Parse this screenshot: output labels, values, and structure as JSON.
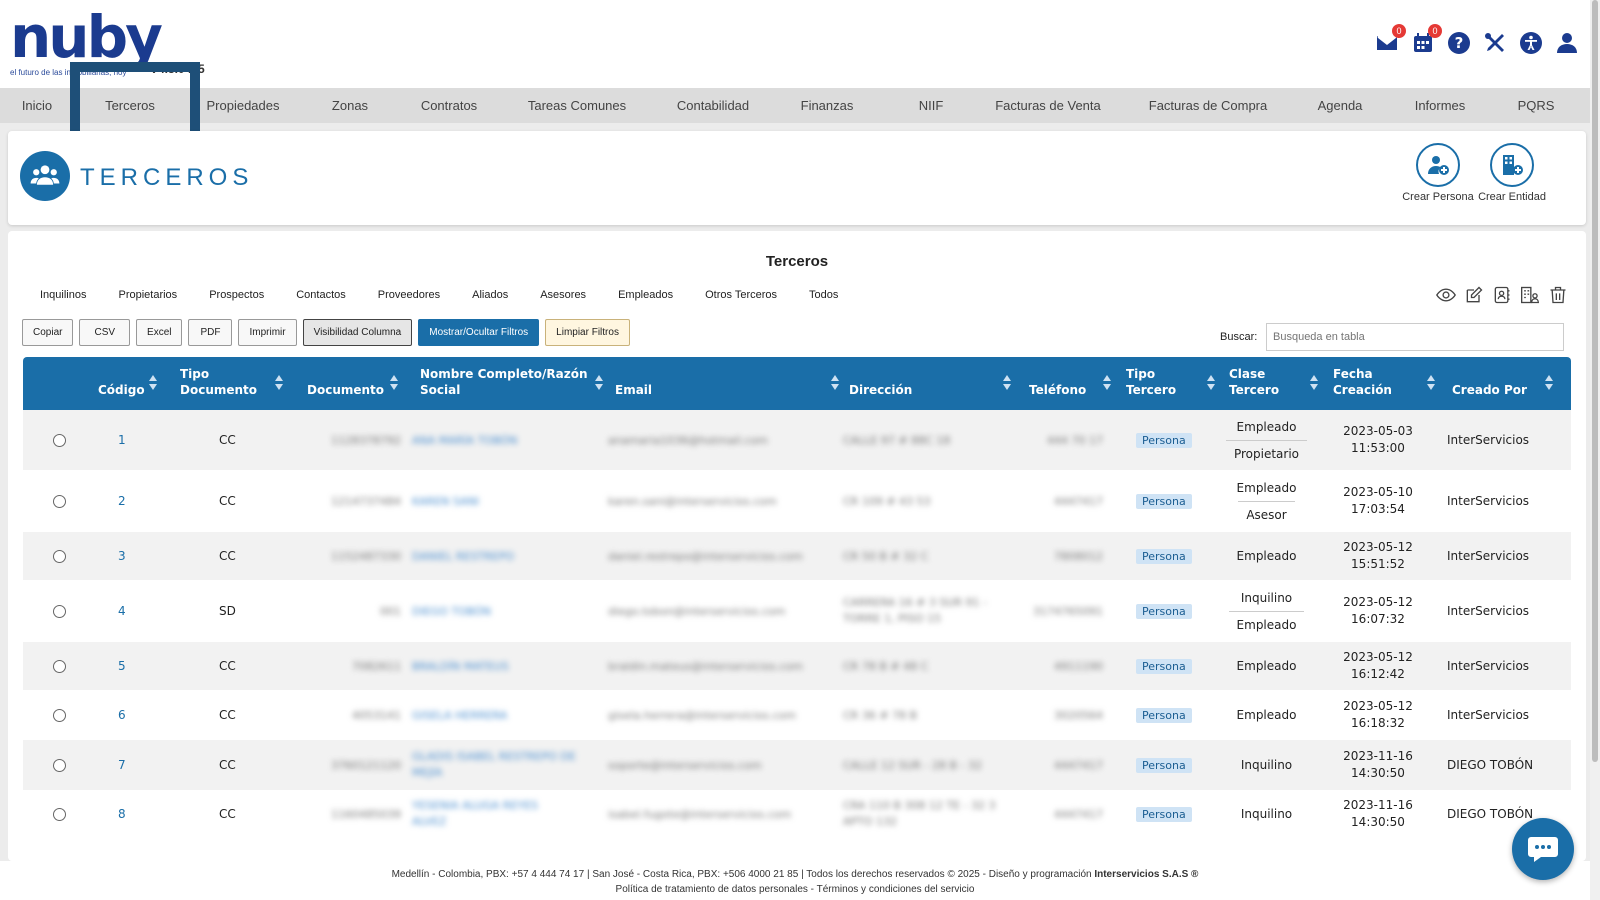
{
  "header": {
    "brand": "nuby",
    "tagline": "el futuro de las inmobiliarias, hoy",
    "version": "V4.5.0 .15",
    "mail_badge": "0",
    "calendar_badge": "0"
  },
  "nav": {
    "items": [
      "Inicio",
      "Terceros",
      "Propiedades",
      "Zonas",
      "Contratos",
      "Tareas Comunes",
      "Contabilidad",
      "Finanzas",
      "NIIF",
      "Facturas de Venta",
      "Facturas de Compra",
      "Agenda",
      "Informes",
      "PQRS"
    ]
  },
  "page": {
    "title": "TERCEROS",
    "create_person": "Crear Persona",
    "create_entity": "Crear Entidad"
  },
  "table": {
    "title": "Terceros",
    "filters": [
      "Inquilinos",
      "Propietarios",
      "Prospectos",
      "Contactos",
      "Proveedores",
      "Aliados",
      "Asesores",
      "Empleados",
      "Otros Terceros",
      "Todos"
    ],
    "buttons": {
      "copy": "Copiar",
      "csv": "CSV",
      "excel": "Excel",
      "pdf": "PDF",
      "print": "Imprimir",
      "columns": "Visibilidad Columna",
      "toggle_filters": "Mostrar/Ocultar Filtros",
      "clear_filters": "Limpiar Filtros"
    },
    "search_label": "Buscar:",
    "search_placeholder": "Busqueda en tabla",
    "columns": {
      "codigo": "Código",
      "tipo_doc": "Tipo Documento",
      "documento": "Documento",
      "nombre": "Nombre Completo/Razón Social",
      "email": "Email",
      "direccion": "Dirección",
      "telefono": "Teléfono",
      "tipo_tercero": "Tipo Tercero",
      "clase_tercero": "Clase Tercero",
      "fecha": "Fecha Creación",
      "creado_por": "Creado Por"
    },
    "rows": [
      {
        "code": "1",
        "doc_type": "CC",
        "document": "1128378792",
        "name": "ANA MARÍA TOBÓN",
        "email": "anamaria1036@hotmail.com",
        "address": "CALLE 97 # 88C 18",
        "phone": "444 70 17",
        "type": "Persona",
        "clases": [
          "Empleado",
          "Propietario"
        ],
        "date": "2023-05-03",
        "time": "11:53:00",
        "created_by": "InterServicios"
      },
      {
        "code": "2",
        "doc_type": "CC",
        "document": "1214737484",
        "name": "KAREN SANI",
        "email": "karen.sani@interservicios.com",
        "address": "CR 109 # 43 53",
        "phone": "4447417",
        "type": "Persona",
        "clases": [
          "Empleado",
          "Asesor"
        ],
        "date": "2023-05-10",
        "time": "17:03:54",
        "created_by": "InterServicios"
      },
      {
        "code": "3",
        "doc_type": "CC",
        "document": "1152487330",
        "name": "DANIEL RESTREPO",
        "email": "daniel.restrepo@interservicios.com",
        "address": "CR 50 B # 32 C",
        "phone": "7808012",
        "type": "Persona",
        "clases": [
          "Empleado"
        ],
        "date": "2023-05-12",
        "time": "15:51:52",
        "created_by": "InterServicios"
      },
      {
        "code": "4",
        "doc_type": "SD",
        "document": "001",
        "name": "DIEGO TOBÓN",
        "email": "diego.tobon@interservicios.com",
        "address": "CARRERA 16 # 3 SUR 91 - TORRE 1, PISO 15",
        "phone": "3174765091",
        "type": "Persona",
        "clases": [
          "Inquilino",
          "Empleado"
        ],
        "date": "2023-05-12",
        "time": "16:07:32",
        "created_by": "InterServicios"
      },
      {
        "code": "5",
        "doc_type": "CC",
        "document": "7082611",
        "name": "BRALDÍN MATEUS",
        "email": "braldin.mateus@interservicios.com",
        "address": "CR 78 B # 48 C",
        "phone": "4911190",
        "type": "Persona",
        "clases": [
          "Empleado"
        ],
        "date": "2023-05-12",
        "time": "16:12:42",
        "created_by": "InterServicios"
      },
      {
        "code": "6",
        "doc_type": "CC",
        "document": "4053141",
        "name": "GISELA HERRERA",
        "email": "gisela.herrera@interservicios.com",
        "address": "CR 36 # 78 B",
        "phone": "3020564",
        "type": "Persona",
        "clases": [
          "Empleado"
        ],
        "date": "2023-05-12",
        "time": "16:18:32",
        "created_by": "InterServicios"
      },
      {
        "code": "7",
        "doc_type": "CC",
        "document": "3760121120",
        "name": "GLADIS ISABEL RESTREPO DE MEJÍA",
        "email": "soporte@interservicios.com",
        "address": "CALLE 12 SUR - 28 B - 32",
        "phone": "4447417",
        "type": "Persona",
        "clases": [
          "Inquilino"
        ],
        "date": "2023-11-16",
        "time": "14:30:50",
        "created_by": "DIEGO TOBÓN"
      },
      {
        "code": "8",
        "doc_type": "CC",
        "document": "1160485039",
        "name": "YESENIA ALUGA REYES ALVEZ",
        "email": "isabel.fugote@interservicios.com",
        "address": "CRA 110 B 308 12 TE - 32 3 APTO 132",
        "phone": "4447417",
        "type": "Persona",
        "clases": [
          "Inquilino"
        ],
        "date": "2023-11-16",
        "time": "14:30:50",
        "created_by": "DIEGO TOBÓN"
      }
    ]
  },
  "footer": {
    "line1_prefix": "Medellín - Colombia, PBX: +57 4 444 74 17 | San José - Costa Rica, PBX: +506 4000 21 85 | Todos los derechos reservados © 2025 - Diseño y programación",
    "line1_company": "Interservicios S.A.S ®",
    "line2": "Política de tratamiento de datos personales - Términos y condiciones del servicio"
  },
  "colors": {
    "primary": "#1a6ea8",
    "brand": "#1b3b8f",
    "highlight": "#1e4f78"
  }
}
